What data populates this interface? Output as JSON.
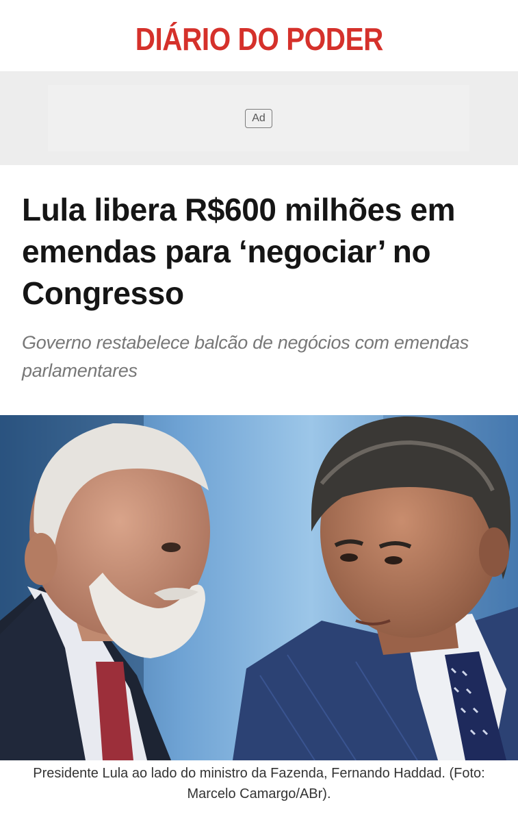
{
  "site": {
    "logo_text": "DIÁRIO DO PODER",
    "brand_color": "#d5312b"
  },
  "ad": {
    "badge_label": "Ad"
  },
  "article": {
    "headline": "Lula libera R$600 milhões em emendas para ‘negociar’ no Congresso",
    "subtitle": "Governo restabelece balcão de negócios com emendas parlamentares",
    "photo_caption": "Presidente Lula ao lado do ministro da Fazenda, Fernando Haddad. (Foto: Marcelo Camargo/ABr)."
  }
}
